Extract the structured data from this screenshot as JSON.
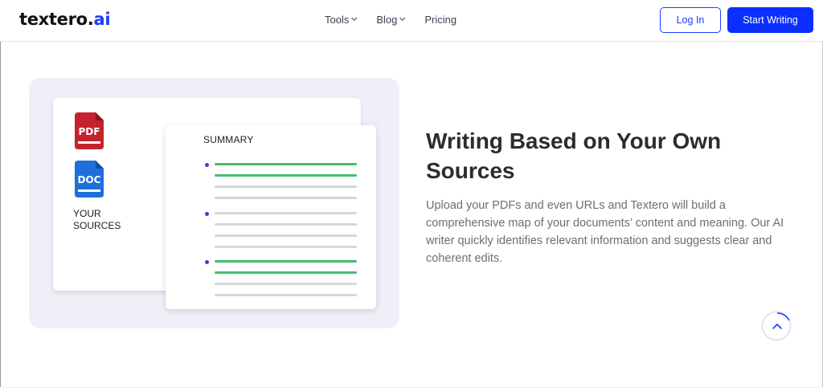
{
  "header": {
    "logo": {
      "name": "textero",
      "dot": ".",
      "suffix": "ai"
    },
    "nav": [
      {
        "label": "Tools",
        "has_dropdown": true
      },
      {
        "label": "Blog",
        "has_dropdown": true
      },
      {
        "label": "Pricing",
        "has_dropdown": false
      }
    ],
    "login_label": "Log In",
    "start_label": "Start Writing"
  },
  "illustration": {
    "pdf_label": "PDF",
    "doc_label": "DOC",
    "sources_line1": "YOUR",
    "sources_line2": "SOURCES",
    "summary_title": "SUMMARY"
  },
  "section": {
    "heading_line1": "Writing Based on Your Own",
    "heading_line2": "Sources",
    "description": "Upload your PDFs and even URLs and Textero will build a comprehensive map of your documents’ content and meaning. Our AI writer quickly identifies relevant information and suggests clear and coherent edits."
  },
  "colors": {
    "brand_blue": "#0a2fff",
    "logo_accent": "#1a3cff",
    "pdf_red": "#c4232d",
    "doc_blue": "#1e6fd9",
    "arrow_purple": "#5a1fe0",
    "bar_green": "#47ba6e",
    "bar_gray": "#d6d6d9",
    "illustration_bg": "#efeff8"
  },
  "icons": {
    "dropdown": "chevron-down-icon",
    "pdf": "pdf-file-icon",
    "doc": "doc-file-icon",
    "arrow": "arrow-right-icon",
    "scroll_top": "chevron-up-icon"
  }
}
